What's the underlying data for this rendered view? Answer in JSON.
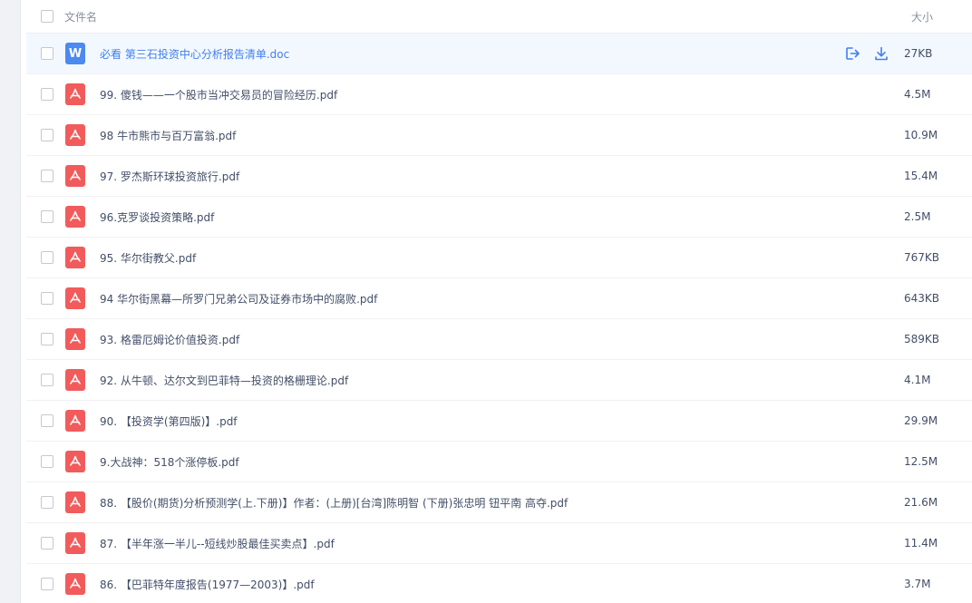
{
  "header": {
    "name_label": "文件名",
    "size_label": "大小"
  },
  "colors": {
    "accent": "#3f7ff0",
    "pdf_icon": "#f25b5b",
    "doc_icon": "#4c89f1",
    "row_highlight": "#f3f8fe"
  },
  "files": [
    {
      "name": "必看 第三石投资中心分析报告清单.doc",
      "size": "27KB",
      "type": "doc",
      "icon": "word-file-icon",
      "icon_letter": "W",
      "highlighted": true
    },
    {
      "name": "99.   傻钱——一个股市当冲交易员的冒险经历.pdf",
      "size": "4.5M",
      "type": "pdf",
      "icon": "pdf-file-icon"
    },
    {
      "name": "98   牛市熊市与百万富翁.pdf",
      "size": "10.9M",
      "type": "pdf",
      "icon": "pdf-file-icon"
    },
    {
      "name": "97.   罗杰斯环球投资旅行.pdf",
      "size": "15.4M",
      "type": "pdf",
      "icon": "pdf-file-icon"
    },
    {
      "name": "96.克罗谈投资策略.pdf",
      "size": "2.5M",
      "type": "pdf",
      "icon": "pdf-file-icon"
    },
    {
      "name": "95.   华尔街教父.pdf",
      "size": "767KB",
      "type": "pdf",
      "icon": "pdf-file-icon"
    },
    {
      "name": "94   华尔街黑幕—所罗门兄弟公司及证券市场中的腐败.pdf",
      "size": "643KB",
      "type": "pdf",
      "icon": "pdf-file-icon"
    },
    {
      "name": "93.   格雷厄姆论价值投资.pdf",
      "size": "589KB",
      "type": "pdf",
      "icon": "pdf-file-icon"
    },
    {
      "name": "92.   从牛顿、达尔文到巴菲特—投资的格栅理论.pdf",
      "size": "4.1M",
      "type": "pdf",
      "icon": "pdf-file-icon"
    },
    {
      "name": "90.   【投资学(第四版)】.pdf",
      "size": "29.9M",
      "type": "pdf",
      "icon": "pdf-file-icon"
    },
    {
      "name": "9.大战神：518个涨停板.pdf",
      "size": "12.5M",
      "type": "pdf",
      "icon": "pdf-file-icon"
    },
    {
      "name": "88.   【股价(期货)分析预测学(上.下册)】作者：(上册)[台湾]陈明智 (下册)张忠明 钮平南 高夺.pdf",
      "size": "21.6M",
      "type": "pdf",
      "icon": "pdf-file-icon"
    },
    {
      "name": "87.   【半年涨一半儿--短线炒股最佳买卖点】.pdf",
      "size": "11.4M",
      "type": "pdf",
      "icon": "pdf-file-icon"
    },
    {
      "name": "86.   【巴菲特年度报告(1977—2003)】.pdf",
      "size": "3.7M",
      "type": "pdf",
      "icon": "pdf-file-icon"
    }
  ],
  "row_actions": {
    "share_icon": "share-icon",
    "download_icon": "download-icon"
  }
}
